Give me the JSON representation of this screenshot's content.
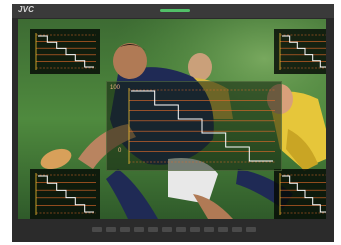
{
  "monitor": {
    "brand": "JVC",
    "bezel_color": "#2a2a2a",
    "power_led_color": "#52c068"
  },
  "waveform": {
    "scale_top_label": "100",
    "scale_bottom_label": "0",
    "trace_color": "#ffffff",
    "graticule_color": "#e06a2a",
    "reference_line_color": "#f0c030"
  },
  "overlays": [
    {
      "name": "waveform-monitor-top-left"
    },
    {
      "name": "waveform-monitor-top-right"
    },
    {
      "name": "waveform-monitor-center"
    },
    {
      "name": "waveform-monitor-bottom-left"
    },
    {
      "name": "waveform-monitor-bottom-right"
    }
  ]
}
